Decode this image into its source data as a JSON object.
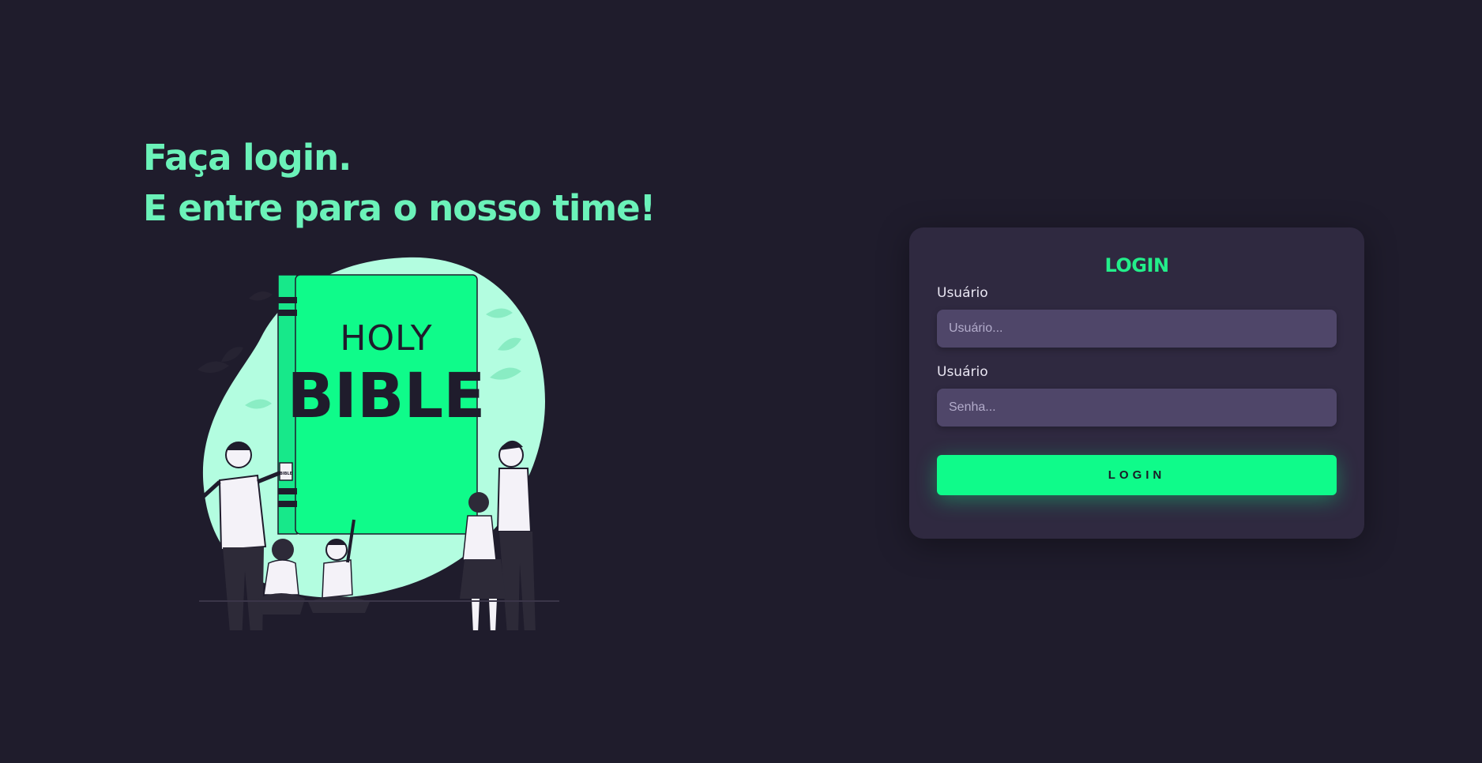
{
  "hero": {
    "line1": "Faça login.",
    "line2": "E entre para o nosso time!",
    "illustration": {
      "book_title_top": "HOLY",
      "book_title_bottom": "BIBLE",
      "small_book_text": "BIBLE"
    }
  },
  "login_card": {
    "title": "LOGIN",
    "username": {
      "label": "Usuário",
      "placeholder": "Usuário..."
    },
    "password": {
      "label": "Usuário",
      "placeholder": "Senha..."
    },
    "submit_label": "LOGIN"
  },
  "colors": {
    "background": "#1f1c2c",
    "headline": "#6bf2b9",
    "accent": "#0ffb8a",
    "card": "#2f2940",
    "input": "#4f4669"
  }
}
